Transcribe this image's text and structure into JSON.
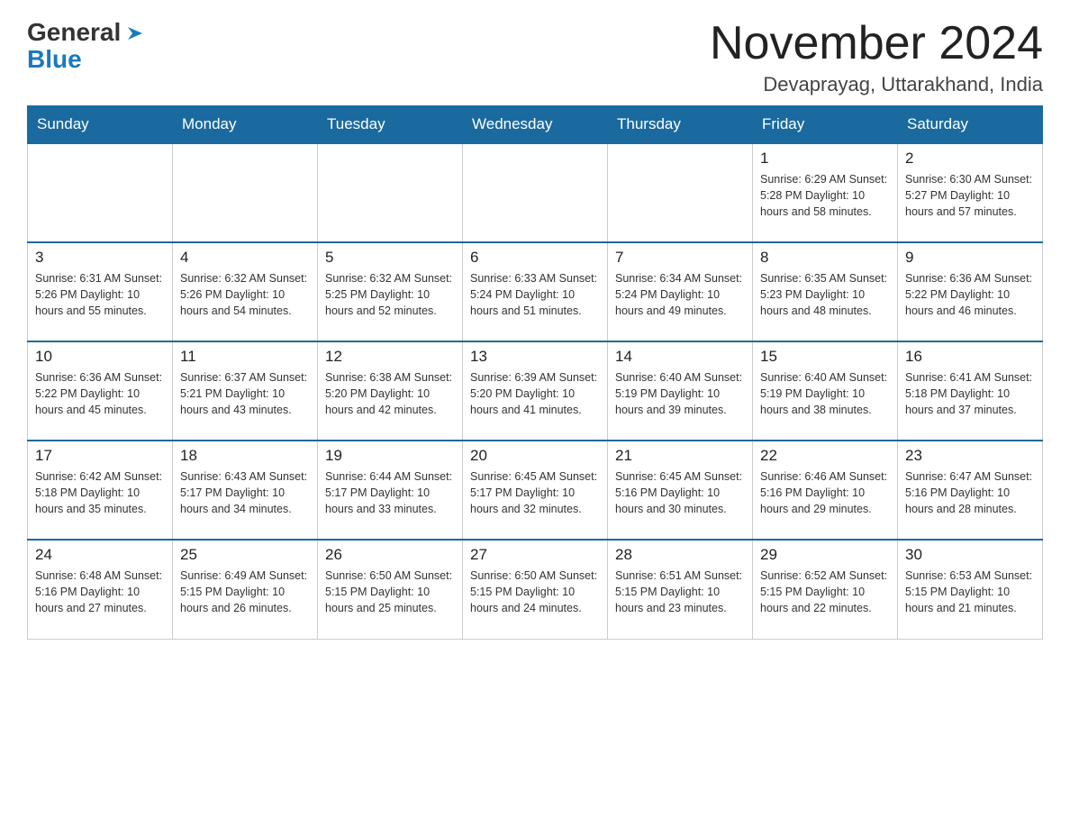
{
  "header": {
    "logo_general": "General",
    "logo_blue": "Blue",
    "month": "November 2024",
    "location": "Devaprayag, Uttarakhand, India"
  },
  "days_of_week": [
    "Sunday",
    "Monday",
    "Tuesday",
    "Wednesday",
    "Thursday",
    "Friday",
    "Saturday"
  ],
  "weeks": [
    {
      "days": [
        {
          "number": "",
          "info": ""
        },
        {
          "number": "",
          "info": ""
        },
        {
          "number": "",
          "info": ""
        },
        {
          "number": "",
          "info": ""
        },
        {
          "number": "",
          "info": ""
        },
        {
          "number": "1",
          "info": "Sunrise: 6:29 AM\nSunset: 5:28 PM\nDaylight: 10 hours and 58 minutes."
        },
        {
          "number": "2",
          "info": "Sunrise: 6:30 AM\nSunset: 5:27 PM\nDaylight: 10 hours and 57 minutes."
        }
      ]
    },
    {
      "days": [
        {
          "number": "3",
          "info": "Sunrise: 6:31 AM\nSunset: 5:26 PM\nDaylight: 10 hours and 55 minutes."
        },
        {
          "number": "4",
          "info": "Sunrise: 6:32 AM\nSunset: 5:26 PM\nDaylight: 10 hours and 54 minutes."
        },
        {
          "number": "5",
          "info": "Sunrise: 6:32 AM\nSunset: 5:25 PM\nDaylight: 10 hours and 52 minutes."
        },
        {
          "number": "6",
          "info": "Sunrise: 6:33 AM\nSunset: 5:24 PM\nDaylight: 10 hours and 51 minutes."
        },
        {
          "number": "7",
          "info": "Sunrise: 6:34 AM\nSunset: 5:24 PM\nDaylight: 10 hours and 49 minutes."
        },
        {
          "number": "8",
          "info": "Sunrise: 6:35 AM\nSunset: 5:23 PM\nDaylight: 10 hours and 48 minutes."
        },
        {
          "number": "9",
          "info": "Sunrise: 6:36 AM\nSunset: 5:22 PM\nDaylight: 10 hours and 46 minutes."
        }
      ]
    },
    {
      "days": [
        {
          "number": "10",
          "info": "Sunrise: 6:36 AM\nSunset: 5:22 PM\nDaylight: 10 hours and 45 minutes."
        },
        {
          "number": "11",
          "info": "Sunrise: 6:37 AM\nSunset: 5:21 PM\nDaylight: 10 hours and 43 minutes."
        },
        {
          "number": "12",
          "info": "Sunrise: 6:38 AM\nSunset: 5:20 PM\nDaylight: 10 hours and 42 minutes."
        },
        {
          "number": "13",
          "info": "Sunrise: 6:39 AM\nSunset: 5:20 PM\nDaylight: 10 hours and 41 minutes."
        },
        {
          "number": "14",
          "info": "Sunrise: 6:40 AM\nSunset: 5:19 PM\nDaylight: 10 hours and 39 minutes."
        },
        {
          "number": "15",
          "info": "Sunrise: 6:40 AM\nSunset: 5:19 PM\nDaylight: 10 hours and 38 minutes."
        },
        {
          "number": "16",
          "info": "Sunrise: 6:41 AM\nSunset: 5:18 PM\nDaylight: 10 hours and 37 minutes."
        }
      ]
    },
    {
      "days": [
        {
          "number": "17",
          "info": "Sunrise: 6:42 AM\nSunset: 5:18 PM\nDaylight: 10 hours and 35 minutes."
        },
        {
          "number": "18",
          "info": "Sunrise: 6:43 AM\nSunset: 5:17 PM\nDaylight: 10 hours and 34 minutes."
        },
        {
          "number": "19",
          "info": "Sunrise: 6:44 AM\nSunset: 5:17 PM\nDaylight: 10 hours and 33 minutes."
        },
        {
          "number": "20",
          "info": "Sunrise: 6:45 AM\nSunset: 5:17 PM\nDaylight: 10 hours and 32 minutes."
        },
        {
          "number": "21",
          "info": "Sunrise: 6:45 AM\nSunset: 5:16 PM\nDaylight: 10 hours and 30 minutes."
        },
        {
          "number": "22",
          "info": "Sunrise: 6:46 AM\nSunset: 5:16 PM\nDaylight: 10 hours and 29 minutes."
        },
        {
          "number": "23",
          "info": "Sunrise: 6:47 AM\nSunset: 5:16 PM\nDaylight: 10 hours and 28 minutes."
        }
      ]
    },
    {
      "days": [
        {
          "number": "24",
          "info": "Sunrise: 6:48 AM\nSunset: 5:16 PM\nDaylight: 10 hours and 27 minutes."
        },
        {
          "number": "25",
          "info": "Sunrise: 6:49 AM\nSunset: 5:15 PM\nDaylight: 10 hours and 26 minutes."
        },
        {
          "number": "26",
          "info": "Sunrise: 6:50 AM\nSunset: 5:15 PM\nDaylight: 10 hours and 25 minutes."
        },
        {
          "number": "27",
          "info": "Sunrise: 6:50 AM\nSunset: 5:15 PM\nDaylight: 10 hours and 24 minutes."
        },
        {
          "number": "28",
          "info": "Sunrise: 6:51 AM\nSunset: 5:15 PM\nDaylight: 10 hours and 23 minutes."
        },
        {
          "number": "29",
          "info": "Sunrise: 6:52 AM\nSunset: 5:15 PM\nDaylight: 10 hours and 22 minutes."
        },
        {
          "number": "30",
          "info": "Sunrise: 6:53 AM\nSunset: 5:15 PM\nDaylight: 10 hours and 21 minutes."
        }
      ]
    }
  ]
}
